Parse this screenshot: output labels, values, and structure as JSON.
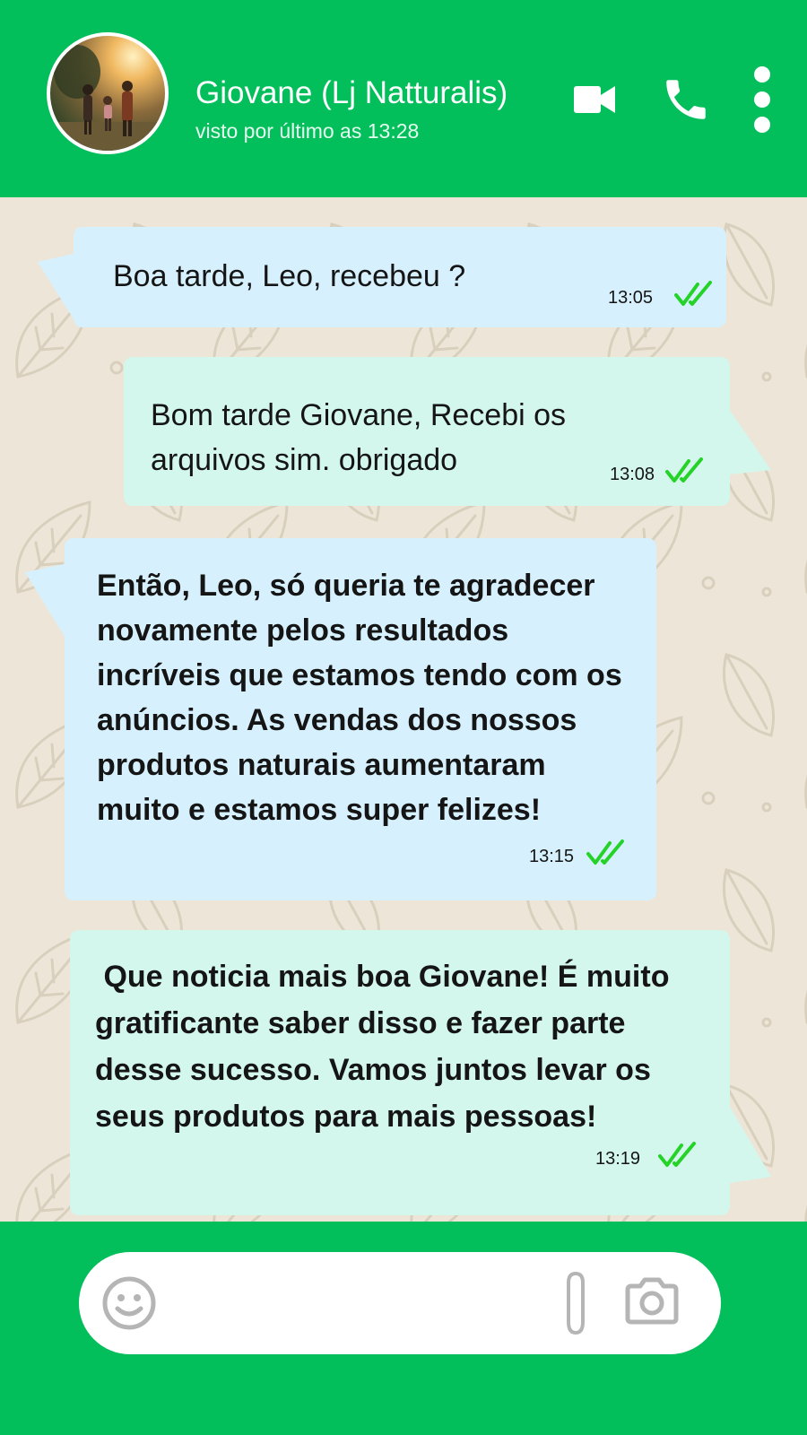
{
  "header": {
    "contact_name": "Giovane (Lj Natturalis)",
    "status": "visto por último as 13:28",
    "avatar_icon": "contact-photo",
    "actions": [
      "video-call-icon",
      "voice-call-icon",
      "more-options-icon"
    ]
  },
  "messages": [
    {
      "direction": "incoming",
      "text": "Boa tarde, Leo, recebeu ?",
      "time": "13:05",
      "status": "read"
    },
    {
      "direction": "outgoing",
      "text": "Bom tarde Giovane, Recebi os arquivos sim. obrigado",
      "time": "13:08",
      "status": "read"
    },
    {
      "direction": "incoming",
      "text": "Então, Leo, só queria te agradecer novamente pelos resultados incríveis que estamos tendo com os anúncios. As vendas dos nossos produtos naturais aumentaram muito e estamos super felizes!",
      "time": "13:15",
      "status": "read"
    },
    {
      "direction": "outgoing",
      "text": " Que noticia mais boa Giovane! É muito gratificante saber disso e fazer parte desse sucesso. Vamos juntos levar os seus produtos para mais pessoas!",
      "time": "13:19",
      "status": "read"
    }
  ],
  "composer": {
    "placeholder": "",
    "icons": [
      "emoji-icon",
      "attachment-icon",
      "camera-icon"
    ]
  },
  "colors": {
    "brand_green": "#03bf5b",
    "chat_background": "#ede6d8",
    "incoming_bubble": "#d6f1fd",
    "outgoing_bubble": "#d3f7ec",
    "read_tick": "#25d228"
  }
}
